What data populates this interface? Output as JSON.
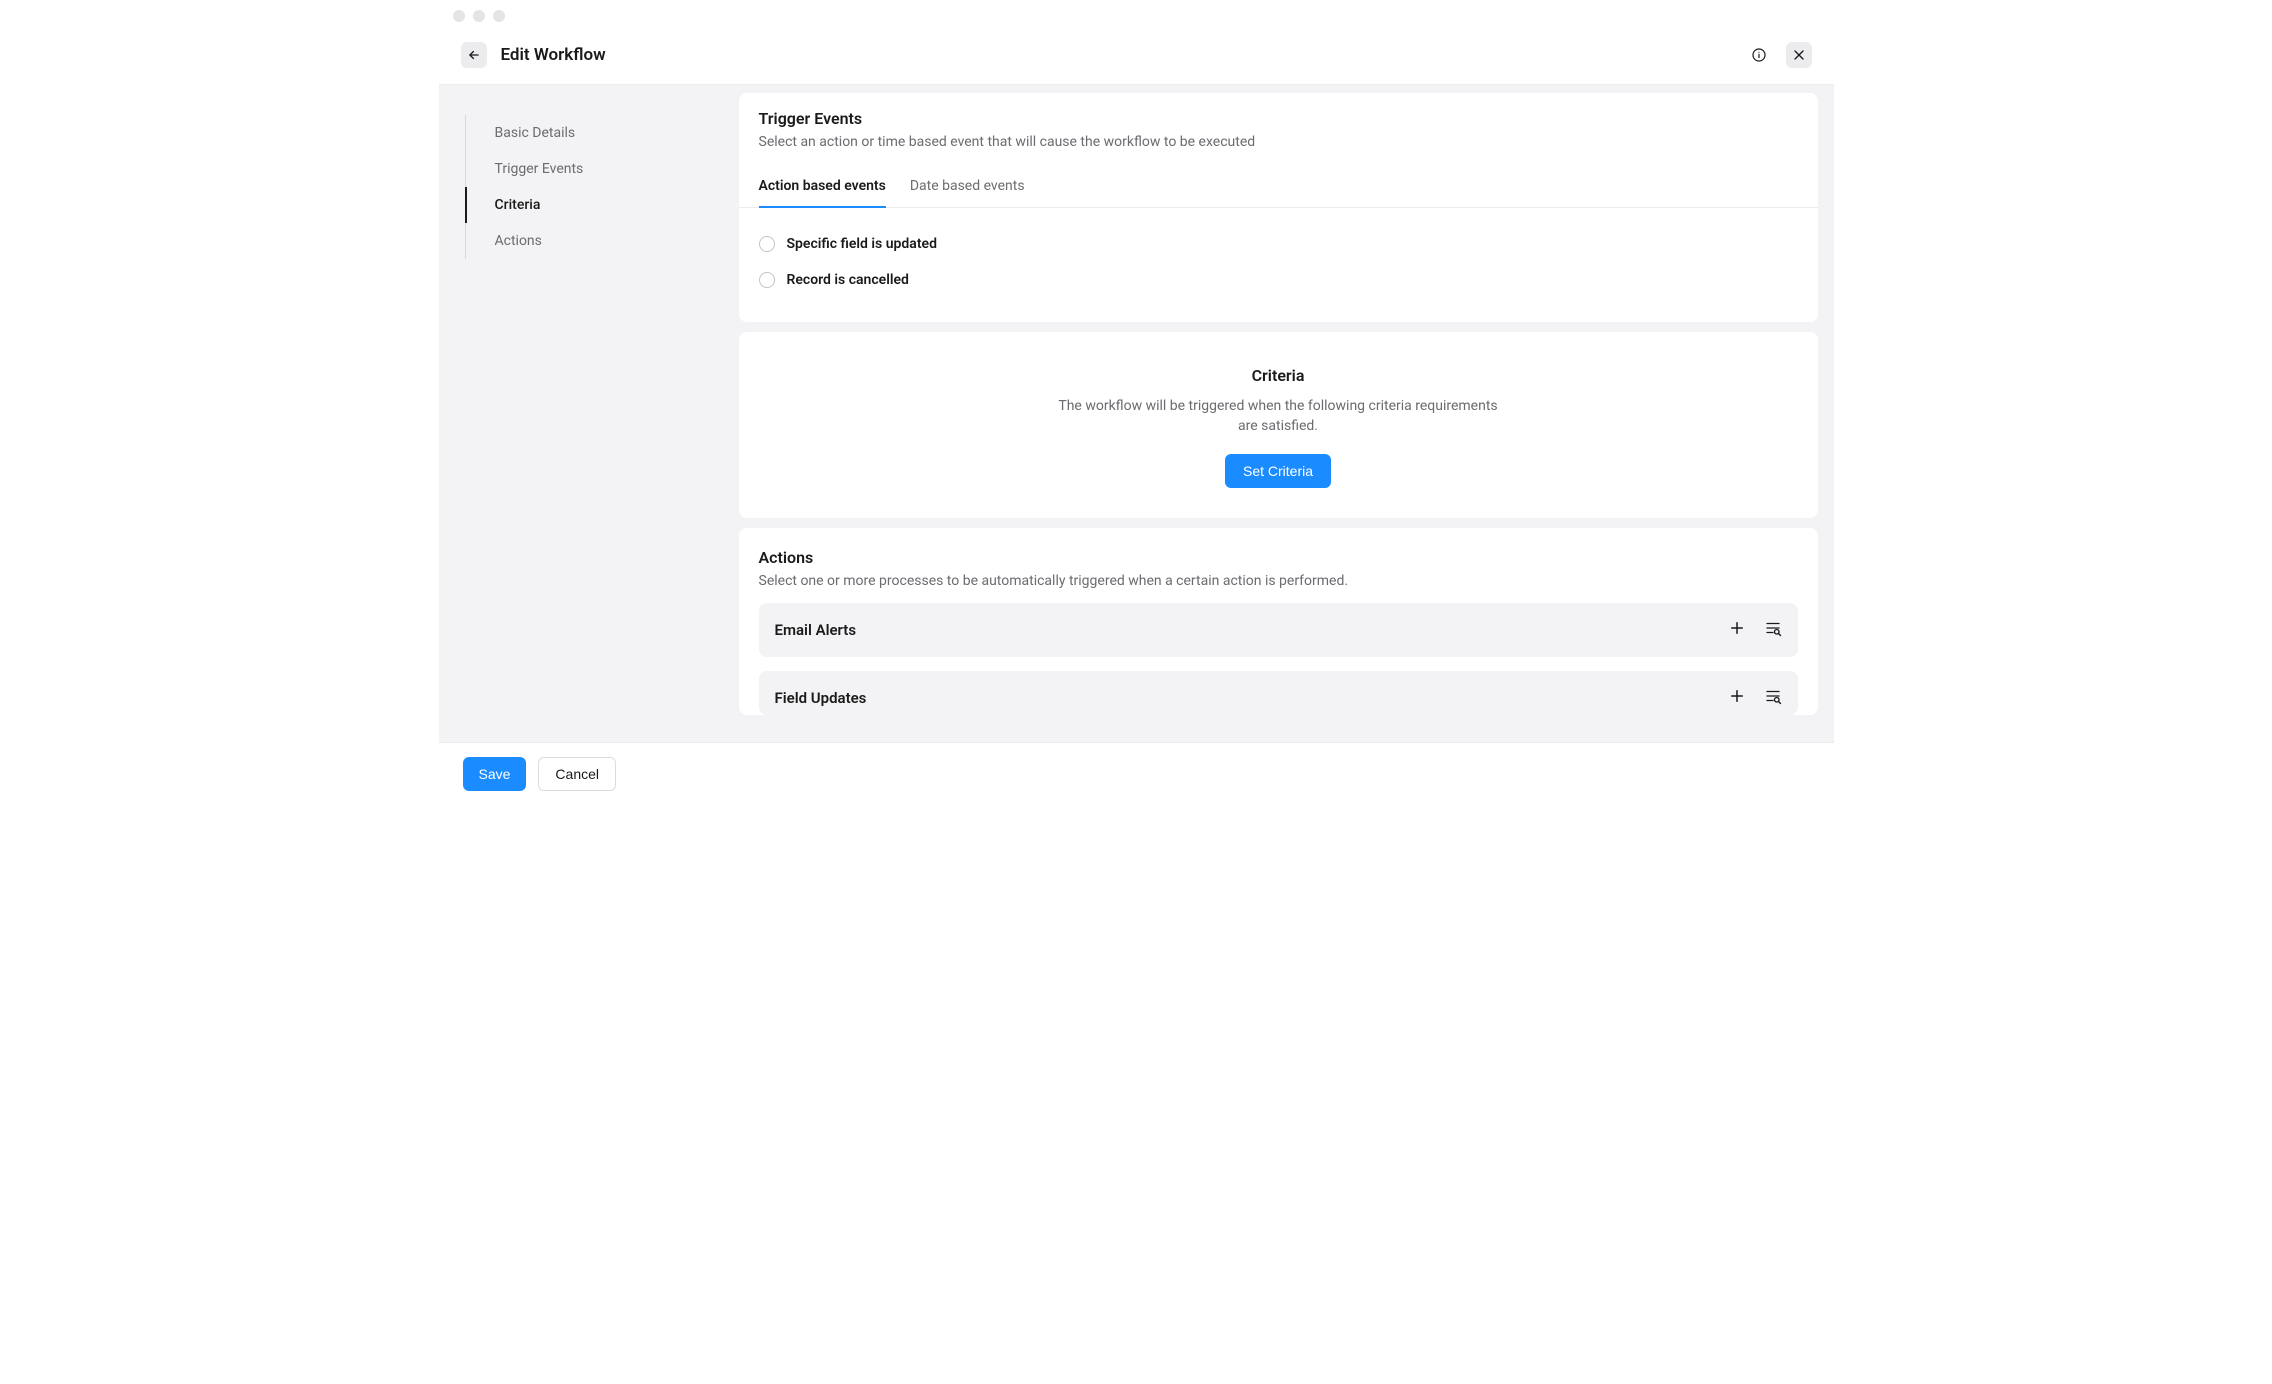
{
  "header": {
    "title": "Edit Workflow"
  },
  "sidebar": {
    "items": [
      {
        "label": "Basic Details"
      },
      {
        "label": "Trigger Events"
      },
      {
        "label": "Criteria"
      },
      {
        "label": "Actions"
      }
    ]
  },
  "trigger": {
    "title": "Trigger Events",
    "description": "Select an action or time based event that will cause the workflow to be executed",
    "tabs": {
      "action": "Action based events",
      "date": "Date based events"
    },
    "options": {
      "specific_field": "Specific field is updated",
      "record_cancelled": "Record is cancelled"
    }
  },
  "criteria": {
    "title": "Criteria",
    "description": "The workflow will be triggered when the following criteria requirements are satisfied.",
    "button": "Set Criteria"
  },
  "actions": {
    "title": "Actions",
    "description": "Select one or more processes to be automatically triggered when a certain action is performed.",
    "rows": {
      "email_alerts": "Email Alerts",
      "field_updates": "Field Updates"
    }
  },
  "footer": {
    "save": "Save",
    "cancel": "Cancel"
  }
}
